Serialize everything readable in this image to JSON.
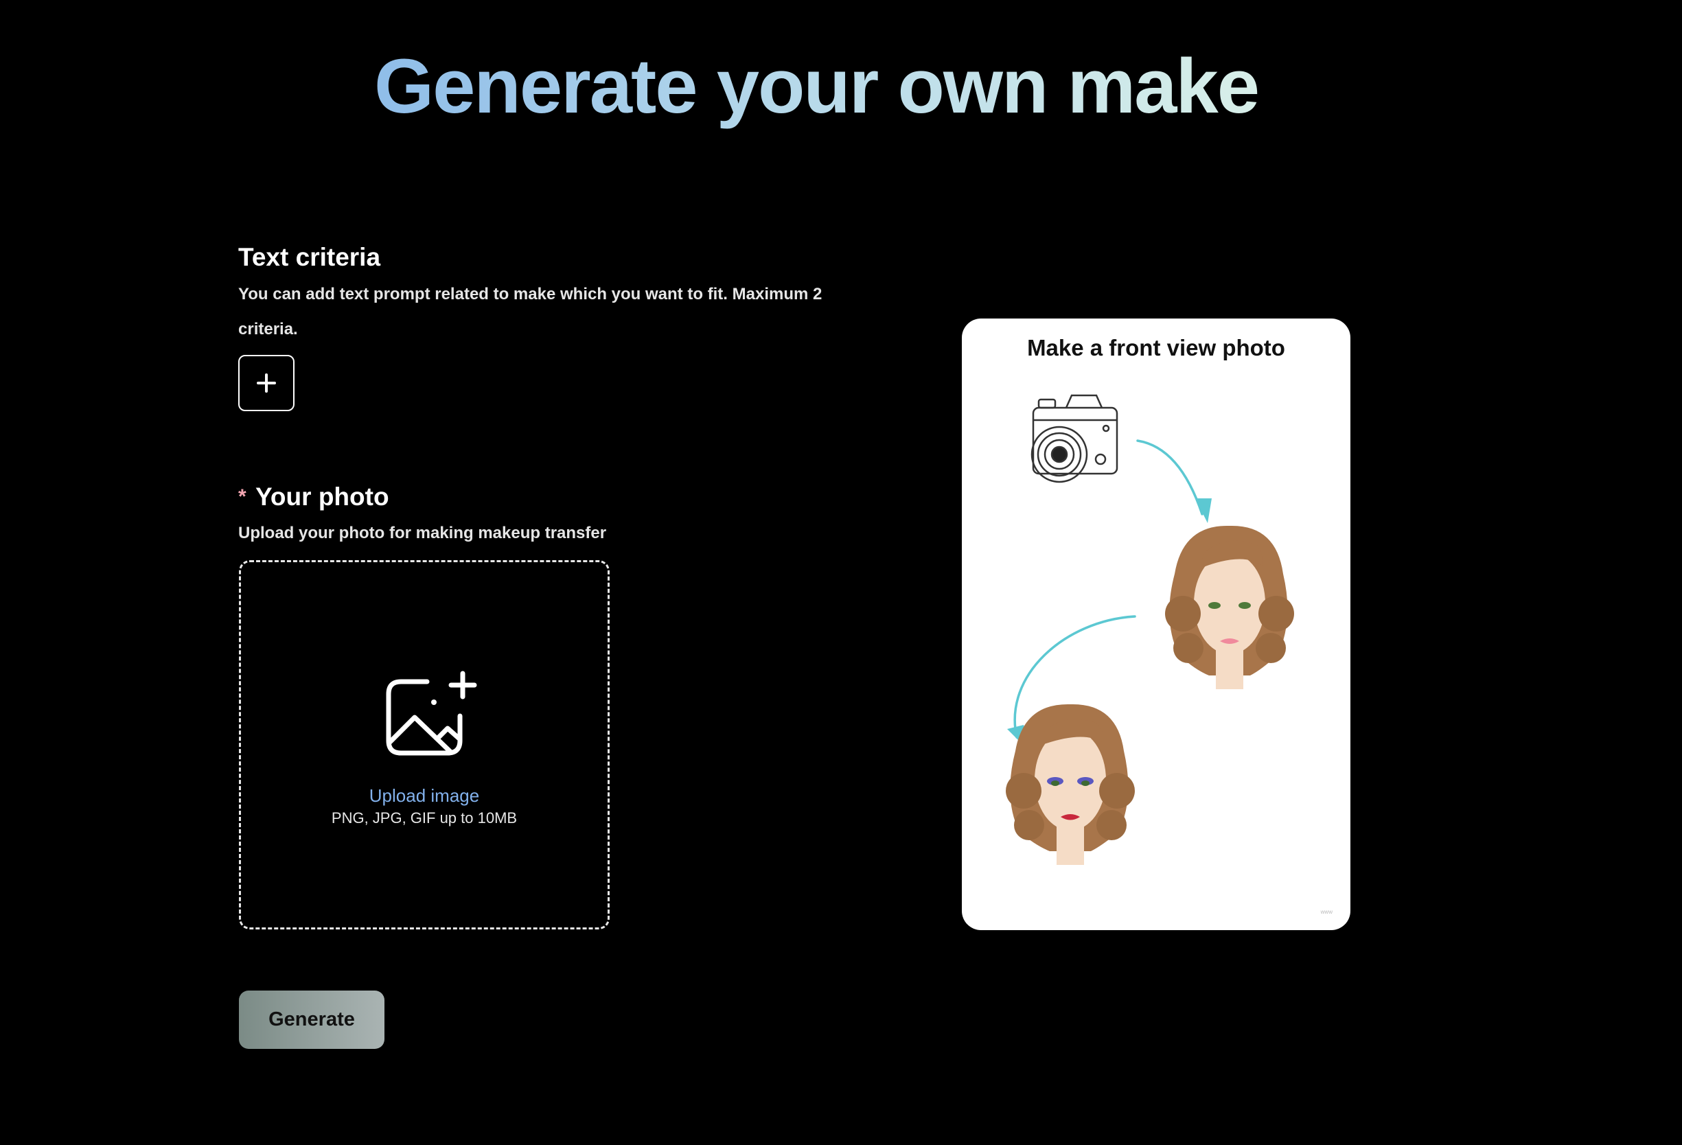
{
  "header": {
    "title": "Generate your own make"
  },
  "text_criteria": {
    "heading": "Text criteria",
    "description": "You can add text prompt related to make which you want to fit. Maximum 2 criteria.",
    "add_icon": "plus-icon"
  },
  "photo": {
    "required_mark": "*",
    "heading": "Your photo",
    "description": "Upload your photo for making makeup transfer",
    "upload_icon": "image-plus-icon",
    "upload_link": "Upload image",
    "upload_hint": "PNG, JPG, GIF up to 10MB"
  },
  "actions": {
    "generate_label": "Generate"
  },
  "guide_card": {
    "title": "Make a front view photo",
    "illustrations": [
      "camera-icon",
      "woman-face-natural",
      "woman-face-made-up"
    ],
    "watermark": "www",
    "arrow_color": "#5cc8d2"
  },
  "colors": {
    "background": "#000000",
    "title_gradient_start": "#8fbde9",
    "title_gradient_end": "#d8efe9",
    "upload_link": "#82b1ec",
    "required_mark": "#f3a6b2",
    "generate_button_start": "#7b8b86",
    "generate_button_end": "#aab4b3"
  }
}
